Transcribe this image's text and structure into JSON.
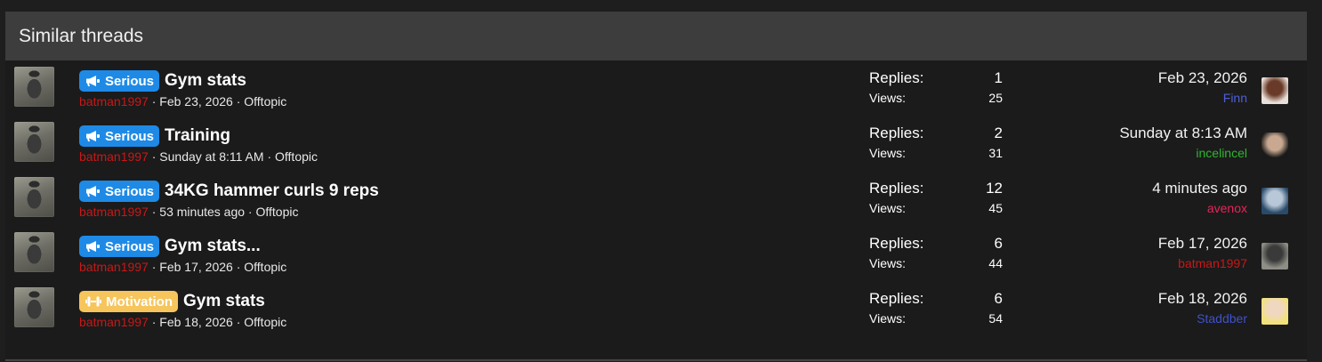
{
  "header": {
    "title": "Similar threads"
  },
  "stats_labels": {
    "replies": "Replies:",
    "views": "Views:"
  },
  "threads": [
    {
      "label": "Serious",
      "label_type": "serious",
      "label_icon": "megaphone-icon",
      "title": "Gym stats",
      "author": "batman1997",
      "sep1": " · ",
      "date": "Feb 23, 2026",
      "sep2": " · ",
      "forum": "Offtopic",
      "replies": "1",
      "views": "25",
      "last_date": "Feb 23, 2026",
      "last_user": "Finn",
      "last_user_color": "#4d5fd6",
      "last_avatar_colors": [
        "#e8e0d8",
        "#6a3a28"
      ]
    },
    {
      "label": "Serious",
      "label_type": "serious",
      "label_icon": "megaphone-icon",
      "title": "Training",
      "author": "batman1997",
      "sep1": " · ",
      "date": "Sunday at 8:11 AM",
      "sep2": " · ",
      "forum": "Offtopic",
      "replies": "2",
      "views": "31",
      "last_date": "Sunday at 8:13 AM",
      "last_user": "incelincel",
      "last_user_color": "#2fb52f",
      "last_avatar_colors": [
        "#1a1a1a",
        "#c8a890"
      ]
    },
    {
      "label": "Serious",
      "label_type": "serious",
      "label_icon": "megaphone-icon",
      "title": "34KG hammer curls 9 reps",
      "author": "batman1997",
      "sep1": " · ",
      "date": "53 minutes ago",
      "sep2": " · ",
      "forum": "Offtopic",
      "replies": "12",
      "views": "45",
      "last_date": "4 minutes ago",
      "last_user": "avenox",
      "last_user_color": "#e8245a",
      "last_avatar_colors": [
        "#2a4a6a",
        "#b8c8d8"
      ]
    },
    {
      "label": "Serious",
      "label_type": "serious",
      "label_icon": "megaphone-icon",
      "title": "Gym stats...",
      "author": "batman1997",
      "sep1": " · ",
      "date": "Feb 17, 2026",
      "sep2": " · ",
      "forum": "Offtopic",
      "replies": "6",
      "views": "44",
      "last_date": "Feb 17, 2026",
      "last_user": "batman1997",
      "last_user_color": "#c81818",
      "last_avatar_colors": [
        "#8e8e86",
        "#3a3a3a"
      ]
    },
    {
      "label": "Motivation",
      "label_type": "motivation",
      "label_icon": "dumbbell-icon",
      "title": "Gym stats",
      "author": "batman1997",
      "sep1": " · ",
      "date": "Feb 18, 2026",
      "sep2": " · ",
      "forum": "Offtopic",
      "replies": "6",
      "views": "54",
      "last_date": "Feb 18, 2026",
      "last_user": "Staddber",
      "last_user_color": "#3f52c8",
      "last_avatar_colors": [
        "#f2e27a",
        "#f0d8c0"
      ]
    }
  ]
}
